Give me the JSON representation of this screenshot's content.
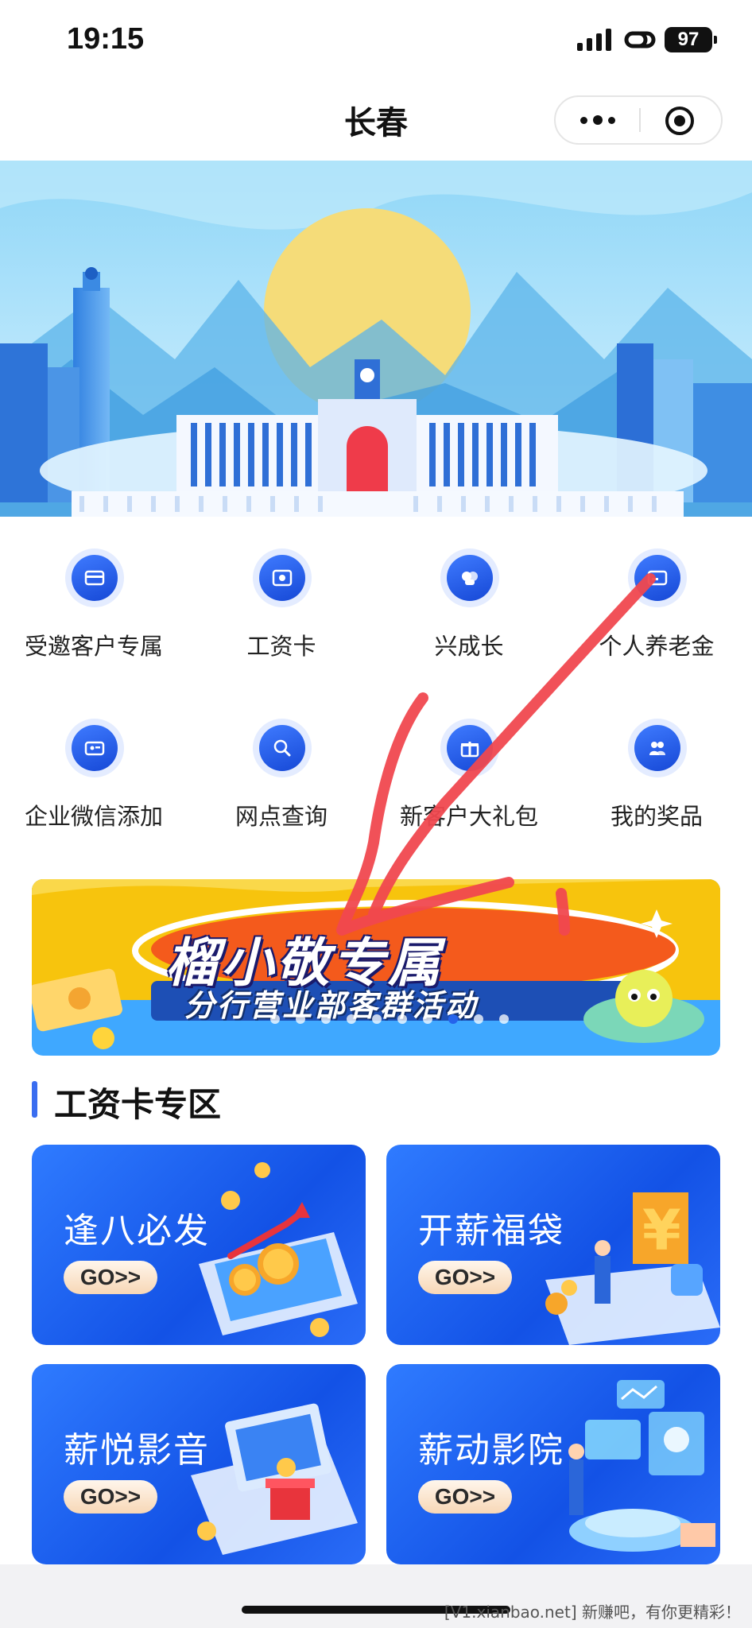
{
  "status_bar": {
    "time": "19:15",
    "battery": "97",
    "icons": [
      "signal-icon",
      "link-icon",
      "battery-icon"
    ]
  },
  "nav": {
    "title": "长春",
    "more_icon": "more-dots-icon",
    "close_icon": "target-circle-icon"
  },
  "colors": {
    "primary": "#1f5ef0",
    "icon_bg": "#e4ecff",
    "annotation_red": "#f0484f",
    "promo_yellow": "#f7c40d",
    "promo_blue": "#3fa8ff",
    "promo_orange": "#f45a1c"
  },
  "services": [
    {
      "label": "受邀客户专属",
      "icon": "card-icon"
    },
    {
      "label": "工资卡",
      "icon": "wallet-card-icon"
    },
    {
      "label": "兴成长",
      "icon": "growth-icon"
    },
    {
      "label": "个人养老金",
      "icon": "pension-card-icon"
    },
    {
      "label": "企业微信添加",
      "icon": "wechat-card-icon"
    },
    {
      "label": "网点查询",
      "icon": "branch-search-icon"
    },
    {
      "label": "新客户大礼包",
      "icon": "gift-icon"
    },
    {
      "label": "我的奖品",
      "icon": "prize-icon"
    }
  ],
  "promo": {
    "title": "榴小敬专属",
    "subtitle": "分行营业部客群活动",
    "slides": 11,
    "active_slide": 8
  },
  "salary_section": {
    "title": "工资卡专区",
    "cards": [
      {
        "title": "逢八必发",
        "go": "GO>>"
      },
      {
        "title": "开薪福袋",
        "go": "GO>>"
      },
      {
        "title": "薪悦影音",
        "go": "GO>>"
      },
      {
        "title": "薪动影院",
        "go": "GO>>"
      }
    ]
  },
  "watermark": "[V1.xianbao.net] 新赚吧，有你更精彩！"
}
